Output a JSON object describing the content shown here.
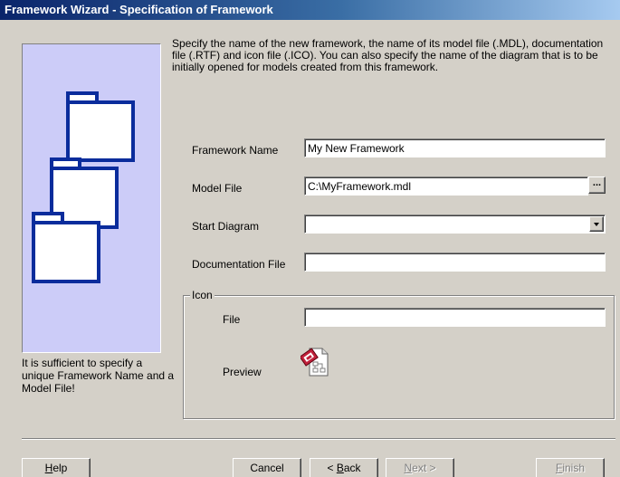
{
  "window": {
    "title": "Framework Wizard - Specification of Framework"
  },
  "intro": "Specify the name of the new framework, the name of its model file (.MDL), documentation file (.RTF) and icon file (.ICO). You can also specify the name of the diagram that is to be initially opened for models created from this framework.",
  "hint": "It is sufficient to specify a unique Framework Name and a Model File!",
  "form": {
    "framework_name": {
      "label": "Framework Name",
      "value": "My New Framework"
    },
    "model_file": {
      "label": "Model File",
      "value": "C:\\MyFramework.mdl",
      "browse_label": "..."
    },
    "start_diagram": {
      "label": "Start Diagram",
      "value": ""
    },
    "documentation_file": {
      "label": "Documentation File",
      "value": ""
    }
  },
  "icon_group": {
    "legend": "Icon",
    "file_label": "File",
    "file_value": "",
    "preview_label": "Preview"
  },
  "buttons": {
    "help": {
      "prefix": "",
      "ul": "H",
      "rest": "elp"
    },
    "cancel": "Cancel",
    "back": {
      "prefix": "< ",
      "ul": "B",
      "rest": "ack"
    },
    "next": {
      "prefix": "",
      "ul": "N",
      "rest": "ext >"
    },
    "finish": {
      "prefix": "",
      "ul": "F",
      "rest": "inish"
    }
  },
  "colors": {
    "panel_bg": "#ccccf8",
    "folder_stroke": "#0a2c9c",
    "titlebar": "#0a246a"
  },
  "icons": {
    "illustration": "stacked-folders-icon",
    "preview": "framework-file-icon"
  }
}
